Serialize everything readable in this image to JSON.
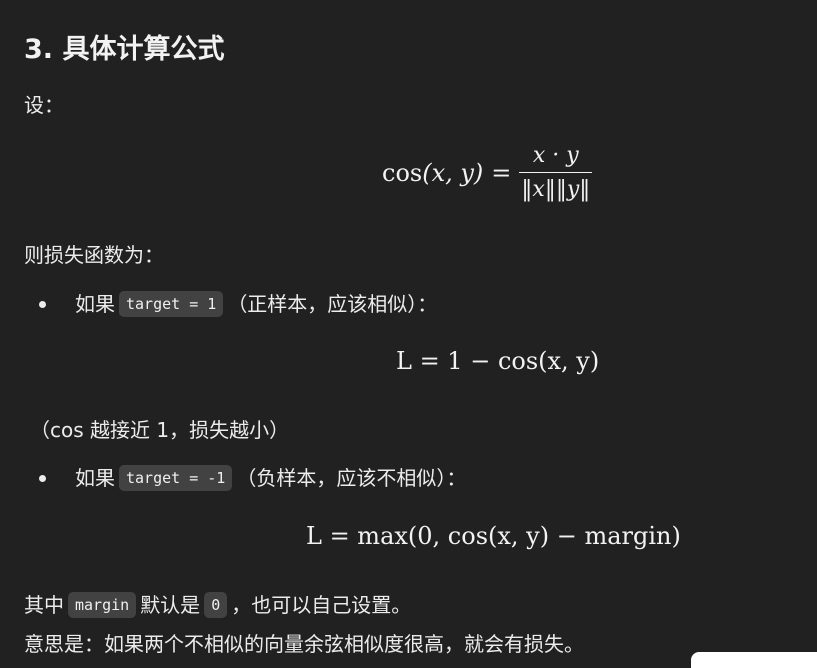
{
  "heading": "3. 具体计算公式",
  "intro": "设：",
  "formula_cos": {
    "lhs": "cos",
    "args": "(x, y)",
    "eq": "=",
    "numerator": "x · y",
    "denominator": "‖x‖‖y‖"
  },
  "loss_intro": "则损失函数为：",
  "bullet1": {
    "prefix": "如果",
    "code": "target = 1",
    "suffix": "（正样本，应该相似）："
  },
  "formula_pos": "L = 1 − cos(x, y)",
  "note_pos": "（cos 越接近 1，损失越小）",
  "bullet2": {
    "prefix": "如果",
    "code": "target = -1",
    "suffix": "（负样本，应该不相似）："
  },
  "formula_neg": "L = max(0, cos(x, y) − margin)",
  "margin_line": {
    "prefix": "其中",
    "code_margin": "margin",
    "middle": "默认是",
    "code_zero": "0",
    "suffix": "，也可以自己设置。"
  },
  "meaning_line": "意思是：如果两个不相似的向量余弦相似度很高，就会有损失。"
}
